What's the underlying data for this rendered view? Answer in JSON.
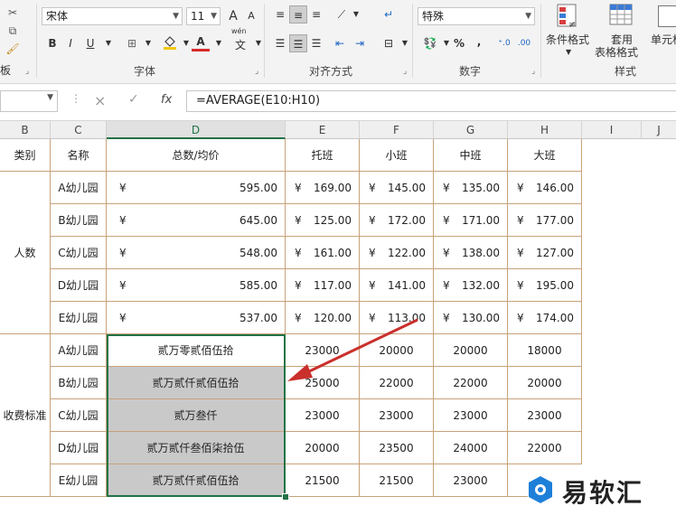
{
  "ribbon": {
    "font_name": "宋体",
    "font_size": "11",
    "number_format": "特殊",
    "grow_font": "A",
    "shrink_font": "A",
    "bold": "B",
    "italic": "I",
    "underline": "U",
    "fill_color_icon": "paint-bucket",
    "font_color_icon": "A",
    "wen_label": "wén",
    "wen_char": "文",
    "percent": "%",
    "comma": ",",
    "group_font": "字体",
    "group_alignment": "对齐方式",
    "group_number": "数字",
    "group_styles": "样式",
    "cut_clip": "板",
    "conditional_format": "条件格式",
    "table_format_line1": "套用",
    "table_format_line2": "表格格式",
    "cell_styles": "单元格",
    "accent_colors": {
      "fill": "#f2c811",
      "font": "#d62b2b",
      "excel_green": "#217346"
    }
  },
  "formula_bar": {
    "formula": "=AVERAGE(E10:H10)",
    "cancel": "×",
    "enter": "✓",
    "fx": "fx"
  },
  "columns": [
    {
      "label": "B"
    },
    {
      "label": "C"
    },
    {
      "label": "D"
    },
    {
      "label": "E"
    },
    {
      "label": "F"
    },
    {
      "label": "G"
    },
    {
      "label": "H"
    },
    {
      "label": "I"
    },
    {
      "label": "J"
    }
  ],
  "table": {
    "header": [
      "类别",
      "名称",
      "总数/均价",
      "托班",
      "小班",
      "中班",
      "大班"
    ],
    "group1_label": "人数",
    "group2_label": "收费标准",
    "currency": "¥",
    "rows_count": [
      {
        "name": "A幼儿园",
        "total": "595.00",
        "vals": [
          "169.00",
          "145.00",
          "135.00",
          "146.00"
        ]
      },
      {
        "name": "B幼儿园",
        "total": "645.00",
        "vals": [
          "125.00",
          "172.00",
          "171.00",
          "177.00"
        ]
      },
      {
        "name": "C幼儿园",
        "total": "548.00",
        "vals": [
          "161.00",
          "122.00",
          "138.00",
          "127.00"
        ]
      },
      {
        "name": "D幼儿园",
        "total": "585.00",
        "vals": [
          "117.00",
          "141.00",
          "132.00",
          "195.00"
        ]
      },
      {
        "name": "E幼儿园",
        "total": "537.00",
        "vals": [
          "120.00",
          "113.00",
          "130.00",
          "174.00"
        ]
      }
    ],
    "rows_fee": [
      {
        "name": "A幼儿园",
        "avg": "贰万零贰佰伍拾",
        "vals": [
          "23000",
          "20000",
          "20000",
          "18000"
        ]
      },
      {
        "name": "B幼儿园",
        "avg": "贰万贰仟贰佰伍拾",
        "vals": [
          "25000",
          "22000",
          "22000",
          "20000"
        ]
      },
      {
        "name": "C幼儿园",
        "avg": "贰万叁仟",
        "vals": [
          "23000",
          "23000",
          "23000",
          "23000"
        ]
      },
      {
        "name": "D幼儿园",
        "avg": "贰万贰仟叁佰柒拾伍",
        "vals": [
          "20000",
          "23500",
          "24000",
          "22000"
        ]
      },
      {
        "name": "E幼儿园",
        "avg": "贰万贰仟贰佰伍拾",
        "vals": [
          "21500",
          "21500",
          "23000",
          ""
        ]
      }
    ]
  },
  "watermark": {
    "text": "易软汇"
  }
}
